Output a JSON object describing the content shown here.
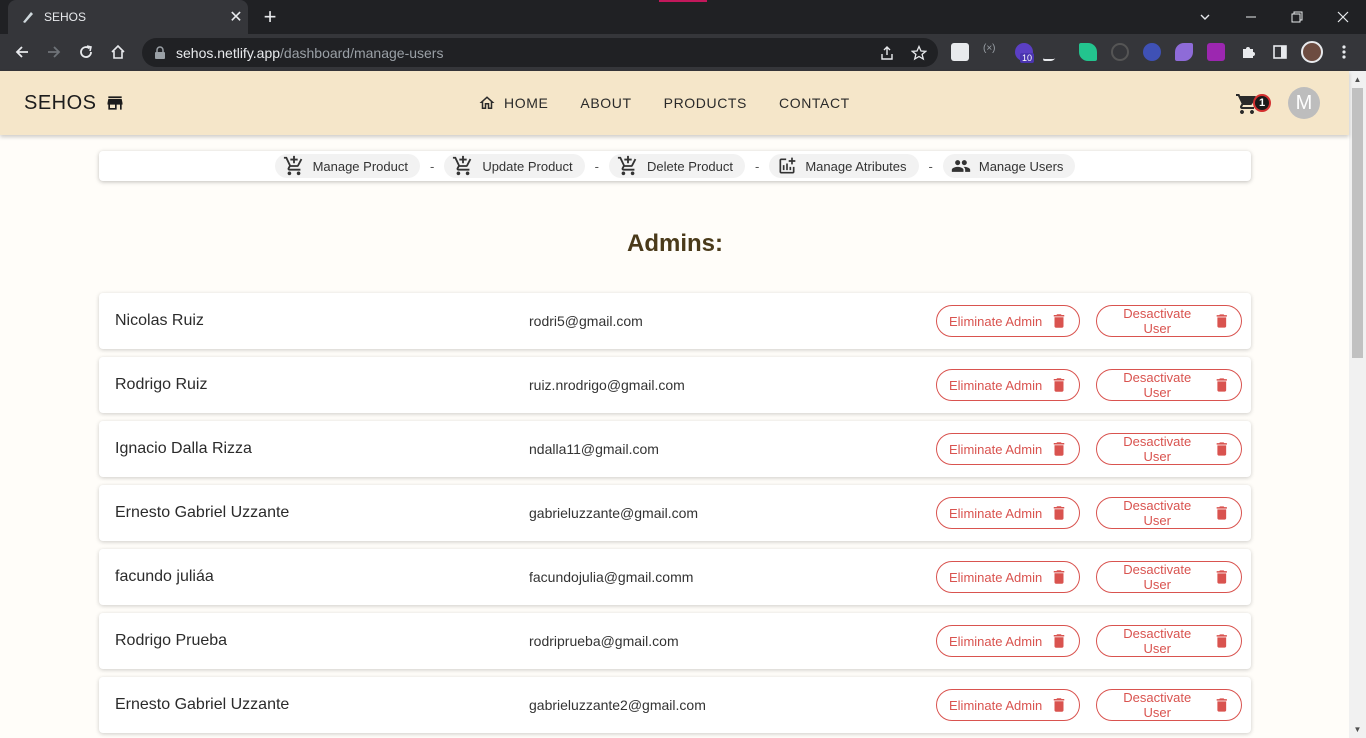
{
  "browser": {
    "tab_title": "SEHOS",
    "tab_close": "✕",
    "new_tab": "+",
    "url_host": "sehos.netlify.app",
    "url_path": "/dashboard/manage-users",
    "extension_badge": "10"
  },
  "header": {
    "brand": "SEHOS",
    "nav": {
      "home": "HOME",
      "about": "ABOUT",
      "products": "PRODUCTS",
      "contact": "CONTACT"
    },
    "cart_count": "1",
    "avatar_initial": "M"
  },
  "subnav": {
    "manage_product": "Manage Product",
    "update_product": "Update Product",
    "delete_product": "Delete Product",
    "manage_atributes": "Manage Atributes",
    "manage_users": "Manage Users",
    "separator": "-"
  },
  "section_title": "Admins:",
  "buttons": {
    "eliminate_admin": "Eliminate Admin",
    "deactivate_user": "Desactivate User"
  },
  "admins": [
    {
      "name": "Nicolas Ruiz",
      "email": "rodri5@gmail.com"
    },
    {
      "name": "Rodrigo Ruiz",
      "email": "ruiz.nrodrigo@gmail.com"
    },
    {
      "name": "Ignacio Dalla Rizza",
      "email": "ndalla11@gmail.com"
    },
    {
      "name": "Ernesto Gabriel Uzzante",
      "email": "gabrieluzzante@gmail.com"
    },
    {
      "name": "facundo juliáa",
      "email": "facundojulia@gmail.comm"
    },
    {
      "name": "Rodrigo Prueba",
      "email": "rodriprueba@gmail.com"
    },
    {
      "name": "Ernesto Gabriel Uzzante",
      "email": "gabrieluzzante2@gmail.com"
    }
  ],
  "colors": {
    "header_bg": "#f5e6c9",
    "danger": "#d9534f",
    "title": "#4a3a1a"
  }
}
